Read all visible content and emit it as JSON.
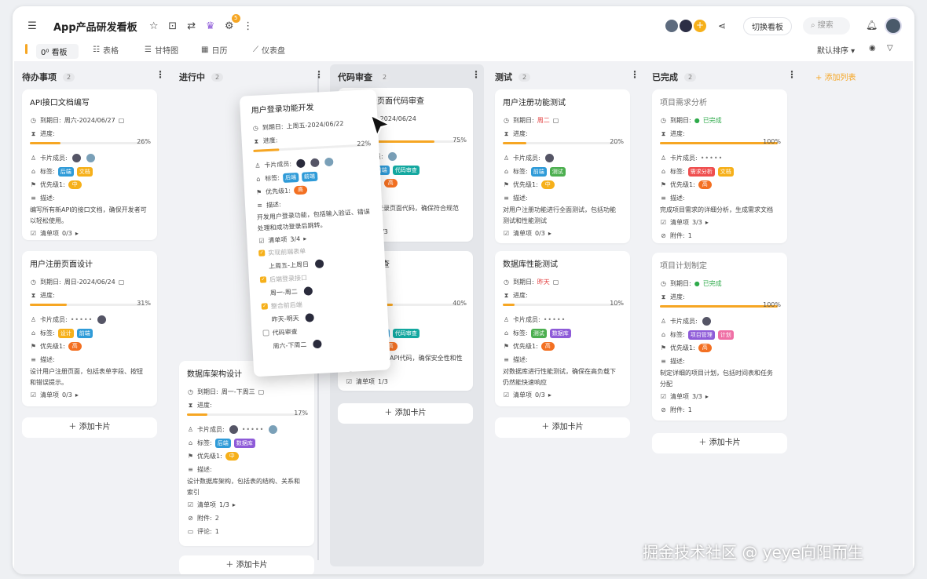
{
  "header": {
    "title": "App产品研发看板",
    "switch_label": "切换看板",
    "search_placeholder": "搜索",
    "robot_badge": "5"
  },
  "tabs": [
    {
      "label": "看板"
    },
    {
      "label": "表格"
    },
    {
      "label": "甘特图"
    },
    {
      "label": "日历"
    },
    {
      "label": "仪表盘"
    }
  ],
  "sort_label": "默认排序",
  "columns": [
    {
      "name": "待办事项",
      "count": "2"
    },
    {
      "name": "进行中",
      "count": "2"
    },
    {
      "name": "代码审查",
      "count": "2"
    },
    {
      "name": "测试",
      "count": "2"
    },
    {
      "name": "已完成",
      "count": "2"
    }
  ],
  "add_list": "+ 添加列表",
  "add_card": "添加卡片",
  "labels": {
    "due": "到期日:",
    "progress": "进度:",
    "members": "卡片成员:",
    "tags": "标签:",
    "priority": "优先级1:",
    "desc": "描述:",
    "checklist": "清单项",
    "attach": "附件:",
    "comments": "评论:"
  },
  "cards": {
    "c1": {
      "title": "API接口文档编写",
      "due": "周六-2024/06/27",
      "pct": "26%",
      "progress": 0.26,
      "tags": [
        "后端",
        "文档"
      ],
      "priority": "中",
      "desc": "编写所有新API的接口文档，确保开发者可以轻松使用。",
      "checklist": "0/3"
    },
    "c2": {
      "title": "用户注册页面设计",
      "due": "周日-2024/06/24",
      "pct": "31%",
      "progress": 0.31,
      "tags": [
        "设计",
        "前端"
      ],
      "priority": "高",
      "desc": "设计用户注册页面，包括表单字段、按钮和错误提示。",
      "checklist": "0/3"
    },
    "c3": {
      "title": "数据库架构设计",
      "due": "周一-下周三",
      "pct": "17%",
      "progress": 0.17,
      "tags": [
        "后端",
        "数据库"
      ],
      "priority": "中",
      "desc": "设计数据库架构，包括表的结构、关系和索引",
      "checklist": "1/3",
      "attach": "2",
      "comments": "1"
    },
    "c4": {
      "title": "前端登录页面代码审查",
      "due": "2024/06/24",
      "pct": "75%",
      "progress": 0.75,
      "tags": [
        "前端",
        "代码审查"
      ],
      "priority": "高",
      "desc": "团队提交的登录页面代码，确保符合规范和功能需求",
      "checklist": "0/3"
    },
    "c5": {
      "title": "API代码审查",
      "pct": "40%",
      "progress": 0.4,
      "tags": [
        "后端",
        "代码审查"
      ],
      "priority": "高",
      "desc": "审查团队提交的API代码，确保安全性和性能",
      "checklist": "1/3"
    },
    "c6": {
      "title": "用户注册功能测试",
      "due": "周二",
      "pct": "20%",
      "progress": 0.2,
      "tags": [
        "前端",
        "测试"
      ],
      "priority": "中",
      "desc": "对用户注册功能进行全面测试，包括功能测试和性能测试",
      "checklist": "0/3"
    },
    "c7": {
      "title": "数据库性能测试",
      "due": "昨天",
      "pct": "10%",
      "progress": 0.1,
      "tags": [
        "测试",
        "数据库"
      ],
      "priority": "高",
      "desc": "对数据库进行性能测试，确保在高负载下仍然能快速响应",
      "checklist": "0/3"
    },
    "c8": {
      "title": "项目需求分析",
      "status": "已完成",
      "pct": "100%",
      "progress": 1.0,
      "tags": [
        "需求分析",
        "文档"
      ],
      "priority": "高",
      "desc": "完成项目需求的详细分析，生成需求文档",
      "checklist": "3/3",
      "attach": "1"
    },
    "c9": {
      "title": "项目计划制定",
      "status": "已完成",
      "pct": "100%",
      "progress": 1.0,
      "tags": [
        "项目管理",
        "计划"
      ],
      "priority": "高",
      "desc": "制定详细的项目计划，包括时间表和任务分配",
      "checklist": "3/3",
      "attach": "1"
    },
    "drag": {
      "title": "用户登录功能开发",
      "due": "上周五-2024/06/22",
      "pct": "22%",
      "progress": 0.22,
      "tags": [
        "后端",
        "前端"
      ],
      "priority": "高",
      "desc": "开发用户登录功能，包括输入验证、错误处理和成功登录后跳转。",
      "checklist": "3/4",
      "subs": [
        {
          "label": "实现前端表单",
          "time": "上周五-上周日",
          "done": true
        },
        {
          "label": "后端登录接口",
          "time": "周一-周二",
          "done": true
        },
        {
          "label": "整合前后端",
          "time": "昨天-明天",
          "done": true
        },
        {
          "label": "代码审查",
          "time": "周六-下周二",
          "done": false
        }
      ]
    }
  },
  "watermark": "掘金技术社区 @ yeye向阳而生",
  "colors": {
    "accent": "#f6a623",
    "blue": "#2f9bd8",
    "purple": "#8e5bd8",
    "teal": "#14a8a0",
    "red": "#ef4f4f",
    "green": "#4caf50"
  }
}
